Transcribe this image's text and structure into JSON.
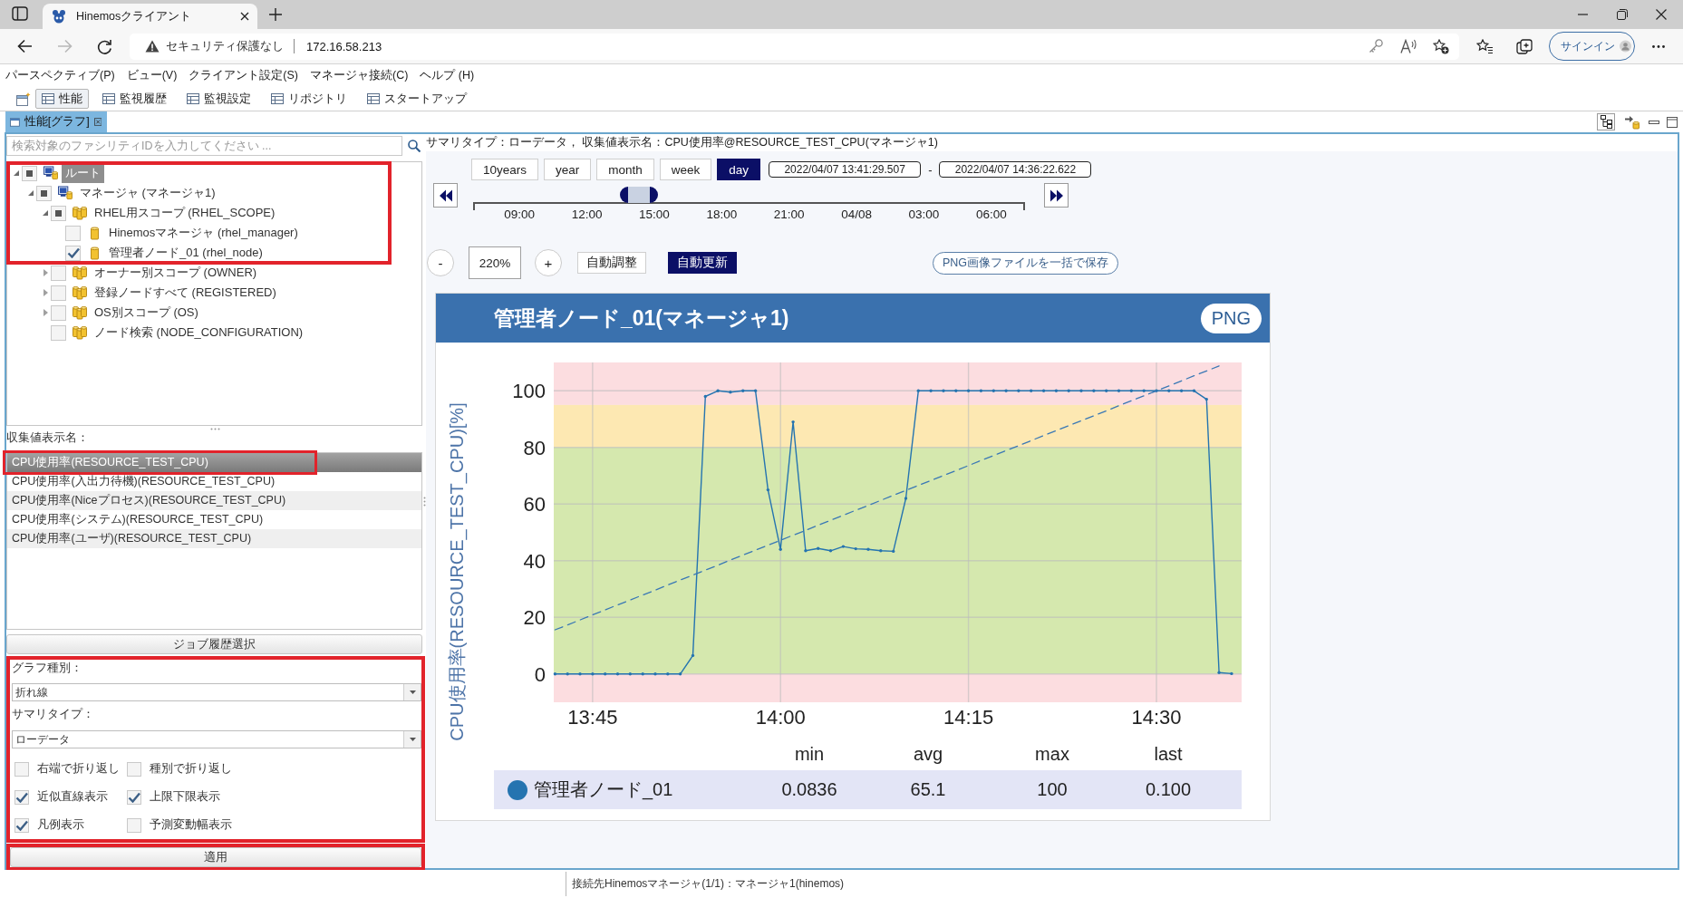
{
  "browser": {
    "tab": {
      "title": "Hinemosクライアント"
    },
    "address": {
      "security": "セキュリティ保護なし",
      "url": "172.16.58.213"
    },
    "sign_in": "サインイン"
  },
  "menu_bar": [
    "パースペクティブ(P)",
    "ビュー(V)",
    "クライアント設定(S)",
    "マネージャ接続(C)",
    "ヘルプ (H)"
  ],
  "perspectives": [
    {
      "label": "性能",
      "selected": true
    },
    {
      "label": "監視履歴",
      "selected": false
    },
    {
      "label": "監視設定",
      "selected": false
    },
    {
      "label": "リポジトリ",
      "selected": false
    },
    {
      "label": "スタートアップ",
      "selected": false
    }
  ],
  "view_tab": {
    "title": "性能[グラフ]",
    "toolbar": [
      {
        "kind": "tree",
        "pressed": true
      },
      {
        "kind": "node",
        "pressed": false
      }
    ]
  },
  "facility_tree": {
    "search": {
      "placeholder": "検索対象のファシリティIDを入力してください ..."
    },
    "items": [
      {
        "label": "ルート",
        "kind": "root",
        "expanded": true,
        "indeterminate": true,
        "selected": true,
        "highlighted": true,
        "children": [
          {
            "label": "マネージャ (マネージャ1)",
            "kind": "manager",
            "expanded": true,
            "indeterminate": true,
            "selected": false,
            "highlighted": true,
            "children": [
              {
                "label": "RHEL用スコープ (RHEL_SCOPE)",
                "kind": "scope",
                "expanded": true,
                "indeterminate": true,
                "selected": false,
                "highlighted": true,
                "children": [
                  {
                    "label": "Hinemosマネージャ (rhel_manager)",
                    "kind": "node",
                    "checked": false,
                    "selected": false,
                    "highlighted": true
                  },
                  {
                    "label": "管理者ノード_01 (rhel_node)",
                    "kind": "node",
                    "checked": true,
                    "selected": false,
                    "highlighted": true
                  }
                ]
              },
              {
                "label": "オーナー別スコープ (OWNER)",
                "kind": "scope",
                "expanded": false,
                "checked": false,
                "selected": false,
                "highlighted": false
              },
              {
                "label": "登録ノードすべて (REGISTERED)",
                "kind": "scope",
                "expanded": false,
                "checked": false,
                "selected": false,
                "highlighted": false
              },
              {
                "label": "OS別スコープ (OS)",
                "kind": "scope",
                "expanded": false,
                "checked": false,
                "selected": false,
                "highlighted": false
              },
              {
                "label": "ノード検索 (NODE_CONFIGURATION)",
                "kind": "scope",
                "checked": false,
                "selected": false,
                "highlighted": false
              }
            ]
          }
        ]
      }
    ]
  },
  "collected_items": {
    "label": "収集値表示名：",
    "items": [
      {
        "label": "CPU使用率(RESOURCE_TEST_CPU)",
        "selected": true,
        "highlighted": true
      },
      {
        "label": "CPU使用率(入出力待機)(RESOURCE_TEST_CPU)",
        "selected": false,
        "highlighted": false
      },
      {
        "label": "CPU使用率(Niceプロセス)(RESOURCE_TEST_CPU)",
        "selected": false,
        "highlighted": false
      },
      {
        "label": "CPU使用率(システム)(RESOURCE_TEST_CPU)",
        "selected": false,
        "highlighted": false
      },
      {
        "label": "CPU使用率(ユーザ)(RESOURCE_TEST_CPU)",
        "selected": false,
        "highlighted": false
      }
    ]
  },
  "job_history_button": "ジョブ履歴選択",
  "options": {
    "highlighted": true,
    "graph_type": {
      "label": "グラフ種別：",
      "value": "折れ線"
    },
    "summary_type": {
      "label": "サマリタイプ：",
      "value": "ローデータ"
    },
    "checkboxes": [
      {
        "label": "右端で折り返し",
        "checked": false
      },
      {
        "label": "種別で折り返し",
        "checked": false
      },
      {
        "label": "近似直線表示",
        "checked": true
      },
      {
        "label": "上限下限表示",
        "checked": true
      },
      {
        "label": "凡例表示",
        "checked": true
      },
      {
        "label": "予測変動幅表示",
        "checked": false
      }
    ]
  },
  "apply_button": {
    "label": "適用",
    "highlighted": true
  },
  "summary": "サマリタイプ：ローデータ， 収集値表示名：CPU使用率@RESOURCE_TEST_CPU(マネージャ1)",
  "range": {
    "buttons": [
      {
        "label": "10years",
        "selected": false
      },
      {
        "label": "year",
        "selected": false
      },
      {
        "label": "month",
        "selected": false
      },
      {
        "label": "week",
        "selected": false
      },
      {
        "label": "day",
        "selected": true
      }
    ],
    "start": "2022/04/07 13:41:29.507",
    "separator": "-",
    "end": "2022/04/07 14:36:22.622"
  },
  "timeline": {
    "level": 0.3,
    "ticks": [
      "09:00",
      "12:00",
      "15:00",
      "18:00",
      "21:00",
      "04/08",
      "03:00",
      "06:00"
    ]
  },
  "zoom": {
    "minus": "-",
    "value": "220%",
    "plus": "+",
    "auto_adjust": {
      "label": "自動調整",
      "on": false
    },
    "auto_update": {
      "label": "自動更新",
      "on": true
    },
    "save_all": "PNG画像ファイルを一括で保存"
  },
  "graph": {
    "title": "管理者ノード_01(マネージャ1)",
    "png_button": "PNG",
    "chart_data": {
      "type": "line",
      "ylabel": "CPU使用率(RESOURCE_TEST_CPU)[%]",
      "categories": [
        null,
        null,
        null,
        "13:45",
        null,
        null,
        null,
        null,
        null,
        null,
        null,
        null,
        null,
        null,
        null,
        null,
        null,
        null,
        "14:00",
        null,
        null,
        null,
        null,
        null,
        null,
        null,
        null,
        null,
        null,
        null,
        null,
        null,
        null,
        "14:15",
        null,
        null,
        null,
        null,
        null,
        null,
        null,
        null,
        null,
        null,
        null,
        null,
        null,
        null,
        "14:30",
        null,
        null,
        null,
        null,
        null,
        null
      ],
      "series": [
        {
          "name": "管理者ノード_01",
          "color": "#2574b0",
          "values": [
            0,
            0,
            0,
            0,
            0,
            0,
            0,
            0,
            0,
            0,
            0,
            6.5,
            98,
            100,
            99.5,
            100,
            100,
            65,
            44,
            89,
            43.5,
            44.3,
            43.5,
            45,
            44.2,
            44,
            43.5,
            43.3,
            62,
            100,
            100,
            100,
            100,
            100,
            100,
            100,
            100,
            100,
            100,
            100,
            100,
            100,
            100,
            100,
            100,
            100,
            100,
            100,
            100,
            100,
            100,
            100,
            97,
            0.5,
            0.1
          ]
        },
        {
          "color": "#3a78b5",
          "line_style": "dashed",
          "values": [
            15.6,
            17.3,
            19.1,
            20.9,
            22.6,
            24.4,
            26.1,
            27.9,
            29.6,
            31.4,
            33.2,
            34.9,
            36.7,
            38.4,
            40.2,
            42.0,
            43.7,
            45.5,
            47.2,
            49.0,
            50.7,
            52.5,
            54.3,
            56.0,
            57.8,
            59.5,
            61.3,
            63.1,
            64.8,
            66.6,
            68.3,
            70.1,
            71.8,
            73.6,
            75.4,
            77.1,
            78.9,
            80.6,
            82.4,
            84.2,
            85.9,
            87.7,
            89.4,
            91.2,
            92.9,
            94.7,
            96.5,
            98.2,
            100.0,
            101.7,
            103.5,
            105.3,
            107.0,
            108.8,
            null
          ]
        }
      ],
      "ylim": [
        -10,
        110
      ],
      "yticks": [
        0,
        20,
        40,
        60,
        80,
        100
      ],
      "grid": true,
      "bands": [
        {
          "axis": "y",
          "from": 95,
          "to": 110,
          "color": "#fcdde0"
        },
        {
          "axis": "y",
          "from": 80,
          "to": 95,
          "color": "#fde8b2"
        },
        {
          "axis": "y",
          "from": 0,
          "to": 80,
          "color": "#d5e8ae"
        },
        {
          "axis": "y",
          "from": -10,
          "to": 0,
          "color": "#fcdde0"
        }
      ]
    },
    "legend": {
      "headers": [
        "min",
        "avg",
        "max",
        "last"
      ],
      "rows": [
        {
          "values": [
            "0.0836",
            "65.1",
            "100",
            "0.100"
          ]
        }
      ]
    }
  },
  "status_bar": "接続先Hinemosマネージャ(1/1)：マネージャ1(hinemos)"
}
